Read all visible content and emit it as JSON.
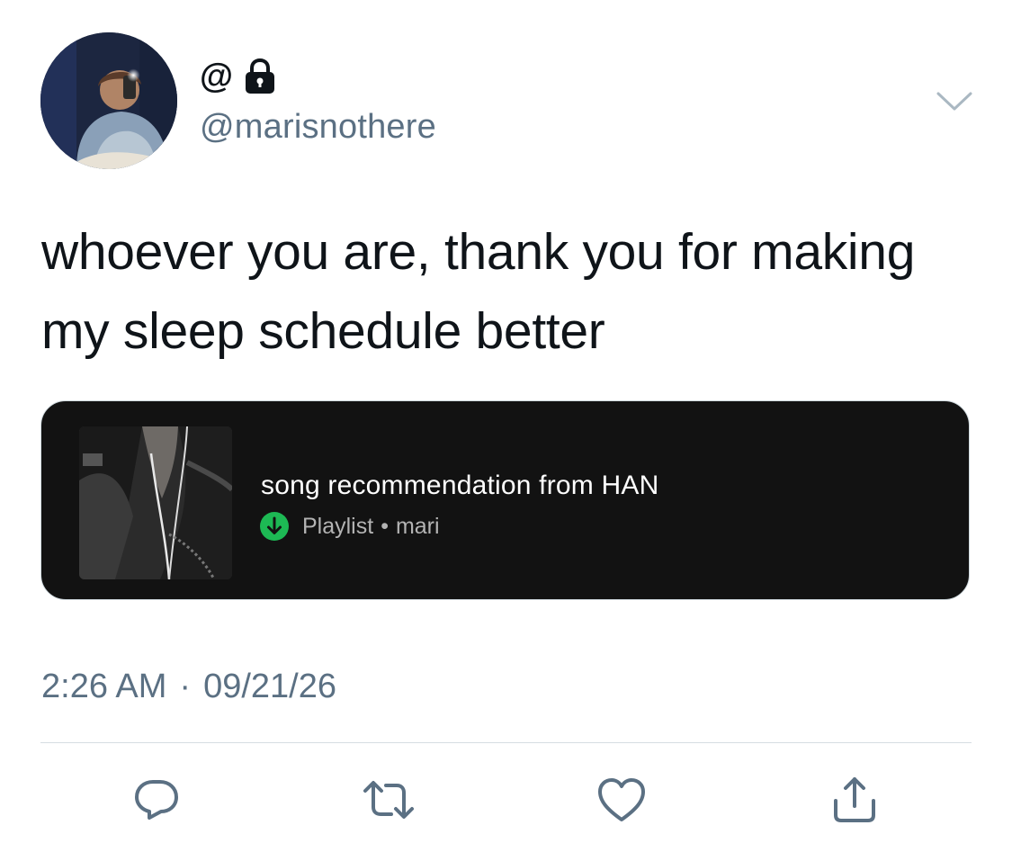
{
  "author": {
    "display_name": "@",
    "handle": "@marisnothere",
    "protected": true
  },
  "tweet": {
    "line1": "whoever you are, thank you for making",
    "line2": "my sleep schedule better"
  },
  "card": {
    "title": "song recommendation from HAN",
    "type": "Playlist",
    "separator": "•",
    "owner": "mari",
    "accent_color": "#1db954"
  },
  "meta": {
    "time": "2:26 AM",
    "dot": "·",
    "date": "09/21/26"
  },
  "icons": {
    "lock": "lock-icon",
    "menu": "chevron-down-icon",
    "reply": "reply-icon",
    "retweet": "retweet-icon",
    "like": "heart-icon",
    "share": "share-icon",
    "download": "download-icon"
  },
  "colors": {
    "secondary_text": "#5b7083",
    "action_icon": "#5b7083",
    "card_bg": "#121212"
  }
}
